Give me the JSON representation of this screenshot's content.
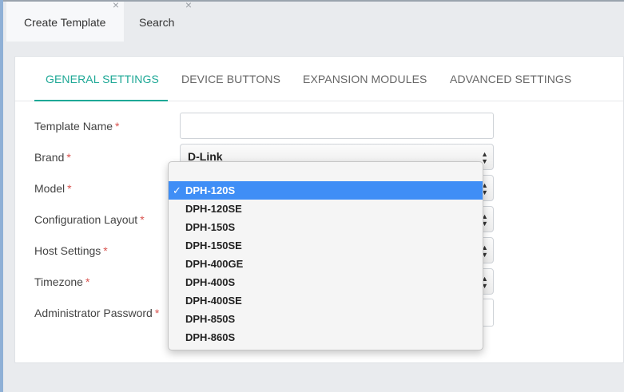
{
  "tabs": [
    {
      "label": "Create Template",
      "close": "×"
    },
    {
      "label": "Search",
      "close": "×"
    }
  ],
  "settings_tabs": [
    {
      "label": "GENERAL SETTINGS"
    },
    {
      "label": "DEVICE BUTTONS"
    },
    {
      "label": "EXPANSION MODULES"
    },
    {
      "label": "ADVANCED SETTINGS"
    }
  ],
  "form": {
    "required_mark": "*",
    "template_name": {
      "label": "Template Name",
      "value": ""
    },
    "brand": {
      "label": "Brand",
      "value": "D-Link"
    },
    "model": {
      "label": "Model",
      "value": "DPH-120S"
    },
    "configuration_layout": {
      "label": "Configuration Layout"
    },
    "host_settings": {
      "label": "Host Settings"
    },
    "timezone": {
      "label": "Timezone"
    },
    "administrator_password": {
      "label": "Administrator Password"
    }
  },
  "model_dropdown": {
    "check": "✓",
    "options": [
      "DPH-120S",
      "DPH-120SE",
      "DPH-150S",
      "DPH-150SE",
      "DPH-400GE",
      "DPH-400S",
      "DPH-400SE",
      "DPH-850S",
      "DPH-860S"
    ],
    "selected_index": 0
  },
  "colors": {
    "accent": "#1ea896",
    "selected_option": "#3f8ef6",
    "required": "#d9534f"
  }
}
